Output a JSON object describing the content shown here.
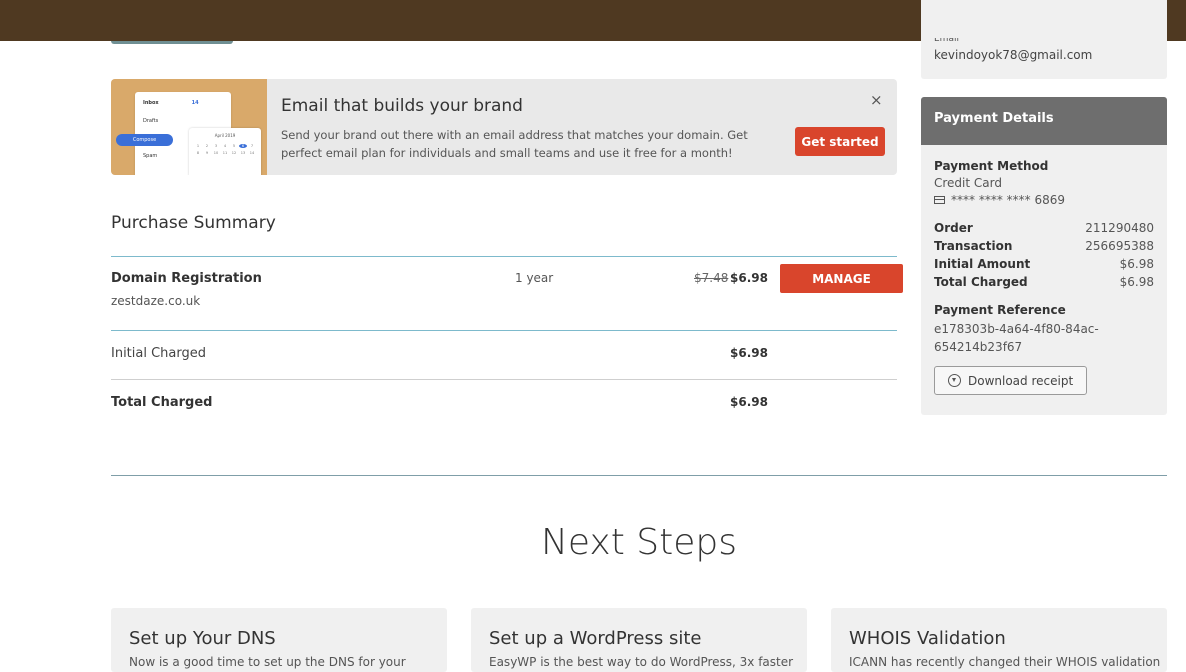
{
  "account": {
    "email_label": "Email",
    "email": "kevindoyok78@gmail.com"
  },
  "promo": {
    "title": "Email that builds your brand",
    "description": "Send your brand out there with an email address that matches your domain. Get perfect email plan for individuals and small teams and use it free for a month!",
    "cta_label": "Get started",
    "close_glyph": "×",
    "mock": {
      "inbox_label": "Inbox",
      "inbox_count": "14",
      "drafts_label": "Drafts",
      "spam_label": "Spam",
      "compose_label": "Compose",
      "calendar_title": "April 2019"
    }
  },
  "summary": {
    "title": "Purchase Summary",
    "item": {
      "name": "Domain Registration",
      "domain": "zestdaze.co.uk",
      "term": "1 year",
      "old_price": "$7.48",
      "price": "$6.98",
      "manage_label": "MANAGE"
    },
    "initial_label": "Initial Charged",
    "initial_value": "$6.98",
    "total_label": "Total Charged",
    "total_value": "$6.98"
  },
  "payment": {
    "title": "Payment Details",
    "method_label": "Payment Method",
    "method_value": "Credit Card",
    "card_masked": "**** **** **** 6869",
    "rows": [
      {
        "key": "Order",
        "value": "211290480"
      },
      {
        "key": "Transaction",
        "value": "256695388"
      },
      {
        "key": "Initial Amount",
        "value": "$6.98"
      },
      {
        "key": "Total Charged",
        "value": "$6.98"
      }
    ],
    "reference_label": "Payment Reference",
    "reference_line1": "e178303b-4a64-4f80-84ac-",
    "reference_line2": "654214b23f67",
    "download_label": "Download receipt"
  },
  "next_steps": {
    "title": "Next Steps",
    "cards": [
      {
        "title": "Set up Your DNS",
        "text": "Now is a good time to set up the DNS for your"
      },
      {
        "title": "Set up a WordPress site",
        "text": "EasyWP is the best way to do WordPress, 3x faster"
      },
      {
        "title": "WHOIS Validation",
        "text": "ICANN has recently changed their WHOIS validation"
      }
    ]
  },
  "colors": {
    "topbar": "#4f3921",
    "accent_red": "#d9452c",
    "divider_blue": "#7dbacc",
    "panel_grey": "#f0f0f0",
    "panel_header": "#6e6e6e"
  },
  "icons": {
    "close": "close-icon",
    "card": "credit-card-icon",
    "download": "download-icon"
  }
}
